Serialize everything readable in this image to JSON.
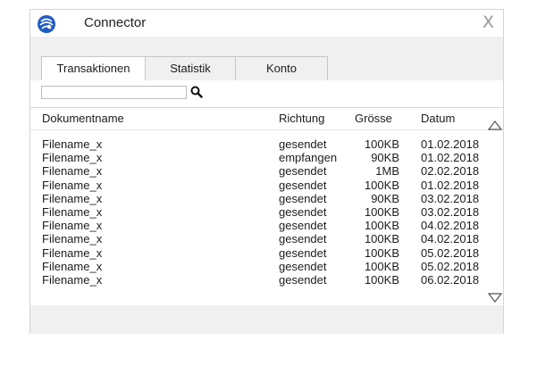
{
  "window": {
    "title": "Connector",
    "close_label": "X"
  },
  "tabs": [
    {
      "label": "Transaktionen",
      "active": true
    },
    {
      "label": "Statistik",
      "active": false
    },
    {
      "label": "Konto",
      "active": false
    }
  ],
  "search": {
    "value": "",
    "placeholder": ""
  },
  "table": {
    "headers": {
      "name": "Dokumentname",
      "direction": "Richtung",
      "size": "Grösse",
      "date": "Datum"
    },
    "rows": [
      {
        "name": "Filename_x",
        "direction": "gesendet",
        "size": "100KB",
        "date": "01.02.2018"
      },
      {
        "name": "Filename_x",
        "direction": "empfangen",
        "size": "90KB",
        "date": "01.02.2018"
      },
      {
        "name": "Filename_x",
        "direction": "gesendet",
        "size": "1MB",
        "date": "02.02.2018"
      },
      {
        "name": "Filename_x",
        "direction": "gesendet",
        "size": "100KB",
        "date": "01.02.2018"
      },
      {
        "name": "Filename_x",
        "direction": "gesendet",
        "size": "90KB",
        "date": "03.02.2018"
      },
      {
        "name": "Filename_x",
        "direction": "gesendet",
        "size": "100KB",
        "date": "03.02.2018"
      },
      {
        "name": "Filename_x",
        "direction": "gesendet",
        "size": "100KB",
        "date": "04.02.2018"
      },
      {
        "name": "Filename_x",
        "direction": "gesendet",
        "size": "100KB",
        "date": "04.02.2018"
      },
      {
        "name": "Filename_x",
        "direction": "gesendet",
        "size": "100KB",
        "date": "05.02.2018"
      },
      {
        "name": "Filename_x",
        "direction": "gesendet",
        "size": "100KB",
        "date": "05.02.2018"
      },
      {
        "name": "Filename_x",
        "direction": "gesendet",
        "size": "100KB",
        "date": "06.02.2018"
      }
    ]
  },
  "icons": {
    "app": "globe-logo-icon",
    "search": "magnifier-icon",
    "scroll_up": "triangle-up-icon",
    "scroll_down": "triangle-down-icon"
  },
  "colors": {
    "logo_blue": "#1f5bc4",
    "panel_gray": "#f0f0f0",
    "close_gray": "#9a9a9a"
  }
}
